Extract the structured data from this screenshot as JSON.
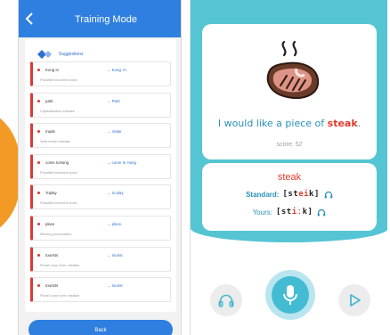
{
  "left_app": {
    "title": "Training Mode",
    "suggestions_label": "Suggestions",
    "items": [
      {
        "word": "Kong in",
        "fix": "→ Kong. In",
        "note": "Possible incorrect word"
      },
      {
        "word": "park",
        "fix": "→ Park",
        "note": "Capitalisation mistake"
      },
      {
        "word": "made",
        "fix": "→ make",
        "note": "Verb tense mistake"
      },
      {
        "word": "come toHong",
        "fix": "→ come to Hong",
        "note": "Possible incorrect word"
      },
      {
        "word": "Toplay",
        "fix": "→ to play",
        "note": "Possible incorrect word"
      },
      {
        "word": "place",
        "fix": "→ place.",
        "note": "Missing punctuation"
      },
      {
        "word": "tourists",
        "fix": "→ tourist",
        "note": "Plural noun form mistake"
      },
      {
        "word": "tourists",
        "fix": "→ tourist",
        "note": "Plural noun form mistake"
      }
    ],
    "back_button": "Back",
    "accent_color": "#2f7fe0",
    "error_color": "#d93939"
  },
  "right_app": {
    "sentence_before": "I would like a piece of ",
    "sentence_highlight": "steak",
    "sentence_after": ".",
    "score_text": "score: 52",
    "word": "steak",
    "standard_label": "Standard:",
    "standard_open": "[st",
    "standard_err": "ei",
    "standard_close": "k]",
    "yours_label": "Yours:",
    "yours_open": "[st",
    "yours_err": "iː",
    "yours_close": "k]",
    "icons": [
      "steam-icon",
      "steak-icon",
      "headphone-icon",
      "microphone-icon",
      "play-icon"
    ],
    "accent_color": "#55c5d4"
  }
}
